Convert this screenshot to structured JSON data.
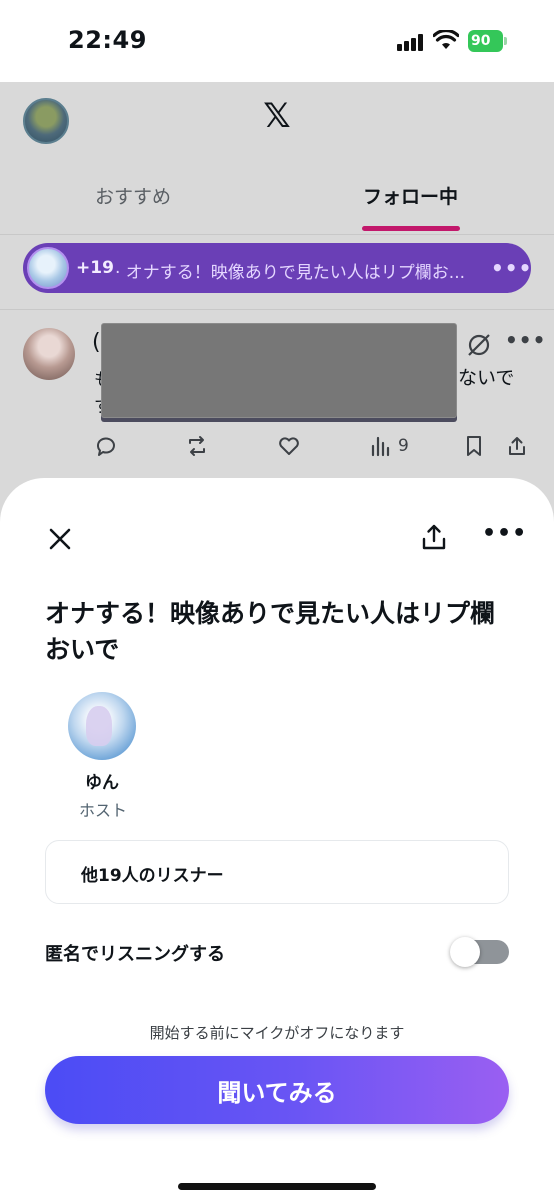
{
  "status_bar": {
    "time": "22:49",
    "battery": "90"
  },
  "feed": {
    "logo": "𝕏",
    "tabs": [
      {
        "label": "おすすめ",
        "active": false
      },
      {
        "label": "フォロー中",
        "active": true
      }
    ],
    "spaces_bar": {
      "count": "+19",
      "title": "· オナする！映像ありで見たい人はリプ欄お..."
    },
    "post": {
      "text_fragment_a": "(",
      "text_fragment_b": "も",
      "text_fragment_c": "す",
      "text_fragment_right": "ないで",
      "view_count": "9"
    }
  },
  "sheet": {
    "title": "オナする！映像ありで見たい人はリプ欄おいで",
    "host": {
      "name": "ゆん",
      "role": "ホスト"
    },
    "listeners": "他19人のリスナー",
    "anonymous_label": "匿名でリスニングする",
    "anonymous_enabled": false,
    "mic_note": "開始する前にマイクがオフになります",
    "listen_button": "聞いてみる"
  },
  "colors": {
    "accent_tab": "#c2186b",
    "spaces_bar": "#6a3fb6",
    "button_start": "#4b4cf5",
    "button_end": "#9a5ff2",
    "battery": "#34c759"
  }
}
